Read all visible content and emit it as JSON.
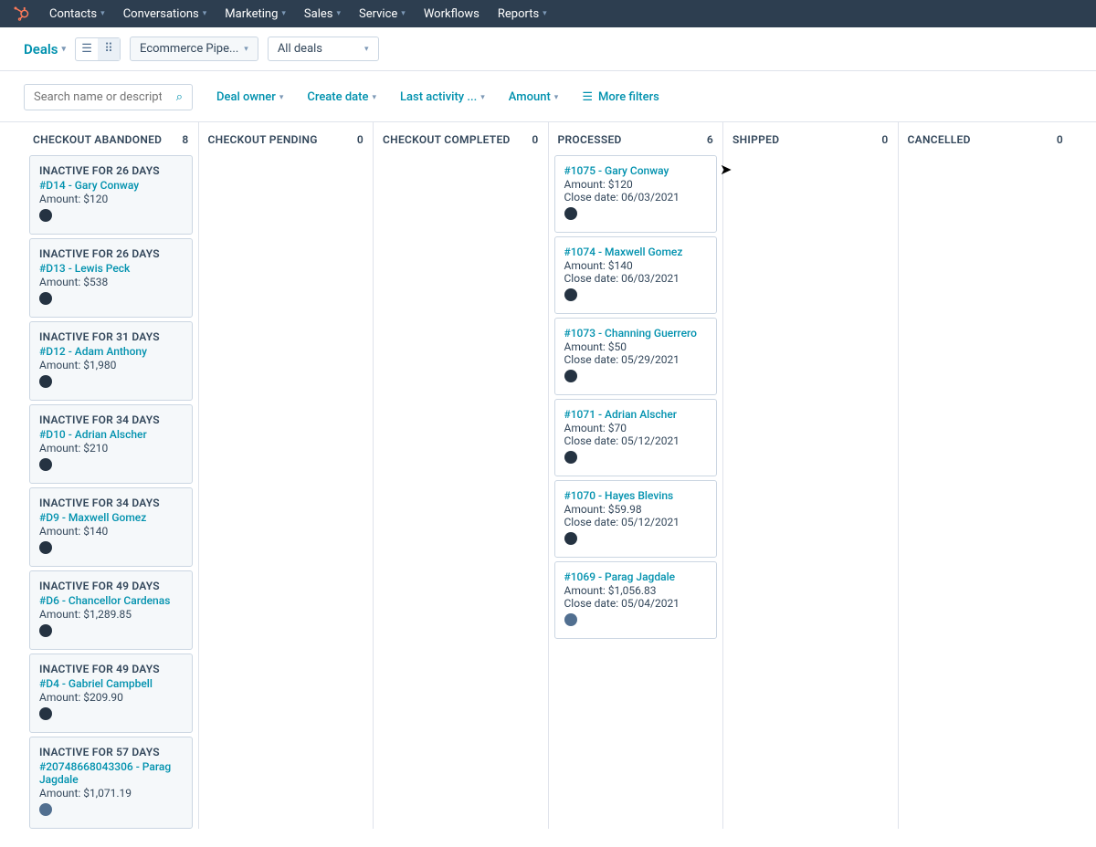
{
  "nav": {
    "items": [
      "Contacts",
      "Conversations",
      "Marketing",
      "Sales",
      "Service",
      "Workflows",
      "Reports"
    ]
  },
  "subbar": {
    "title": "Deals",
    "pipeline": "Ecommerce Pipe...",
    "scope": "All deals"
  },
  "filters": {
    "search_placeholder": "Search name or descriptic",
    "items": [
      "Deal owner",
      "Create date",
      "Last activity ...",
      "Amount"
    ],
    "more": "More filters"
  },
  "columns": [
    {
      "title": "CHECKOUT ABANDONED",
      "count": "8",
      "cards": [
        {
          "inactive": "INACTIVE FOR 26 DAYS",
          "name": "#D14 - Gary Conway",
          "amount": "Amount: $120",
          "avatar": ""
        },
        {
          "inactive": "INACTIVE FOR 26 DAYS",
          "name": "#D13 - Lewis Peck",
          "amount": "Amount: $538",
          "avatar": ""
        },
        {
          "inactive": "INACTIVE FOR 31 DAYS",
          "name": "#D12 - Adam Anthony",
          "amount": "Amount: $1,980",
          "avatar": ""
        },
        {
          "inactive": "INACTIVE FOR 34 DAYS",
          "name": "#D10 - Adrian Alscher",
          "amount": "Amount: $210",
          "avatar": ""
        },
        {
          "inactive": "INACTIVE FOR 34 DAYS",
          "name": "#D9 - Maxwell Gomez",
          "amount": "Amount: $140",
          "avatar": ""
        },
        {
          "inactive": "INACTIVE FOR 49 DAYS",
          "name": "#D6 - Chancellor Cardenas",
          "amount": "Amount: $1,289.85",
          "avatar": ""
        },
        {
          "inactive": "INACTIVE FOR 49 DAYS",
          "name": "#D4 - Gabriel Campbell",
          "amount": "Amount: $209.90",
          "avatar": ""
        },
        {
          "inactive": "INACTIVE FOR 57 DAYS",
          "name": "#20748668043306 - Parag Jagdale",
          "amount": "Amount: $1,071.19",
          "avatar": "alt"
        }
      ]
    },
    {
      "title": "CHECKOUT PENDING",
      "count": "0",
      "cards": []
    },
    {
      "title": "CHECKOUT COMPLETED",
      "count": "0",
      "cards": []
    },
    {
      "title": "PROCESSED",
      "count": "6",
      "cards": [
        {
          "name": "#1075 - Gary Conway",
          "amount": "Amount: $120",
          "close": "Close date: 06/03/2021",
          "avatar": ""
        },
        {
          "name": "#1074 - Maxwell Gomez",
          "amount": "Amount: $140",
          "close": "Close date: 06/03/2021",
          "avatar": ""
        },
        {
          "name": "#1073 - Channing Guerrero",
          "amount": "Amount: $50",
          "close": "Close date: 05/29/2021",
          "avatar": ""
        },
        {
          "name": "#1071 - Adrian Alscher",
          "amount": "Amount: $70",
          "close": "Close date: 05/12/2021",
          "avatar": ""
        },
        {
          "name": "#1070 - Hayes Blevins",
          "amount": "Amount: $59.98",
          "close": "Close date: 05/12/2021",
          "avatar": ""
        },
        {
          "name": "#1069 - Parag Jagdale",
          "amount": "Amount: $1,056.83",
          "close": "Close date: 05/04/2021",
          "avatar": "alt"
        }
      ]
    },
    {
      "title": "SHIPPED",
      "count": "0",
      "cards": []
    },
    {
      "title": "CANCELLED",
      "count": "0",
      "cards": []
    }
  ]
}
